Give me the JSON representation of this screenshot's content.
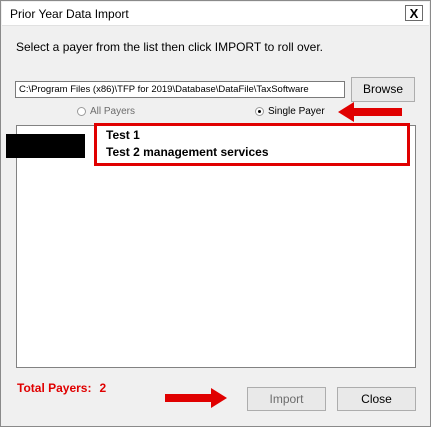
{
  "window": {
    "title": "Prior Year Data Import",
    "close_glyph": "X"
  },
  "instruction": "Select a payer from the list then click IMPORT to roll over.",
  "path": {
    "value": "C:\\Program Files (x86)\\TFP for 2019\\Database\\DataFile\\TaxSoftware"
  },
  "buttons": {
    "browse": "Browse",
    "import": "Import",
    "close": "Close"
  },
  "radios": {
    "all_label": "All Payers",
    "single_label": "Single Payer",
    "selected": "Single Payer"
  },
  "payers": [
    "Test 1",
    "Test 2 management services"
  ],
  "total": {
    "label": "Total Payers:",
    "count": "2"
  },
  "colors": {
    "annotation_red": "#e00000",
    "window_bg": "#f0f0f0"
  }
}
